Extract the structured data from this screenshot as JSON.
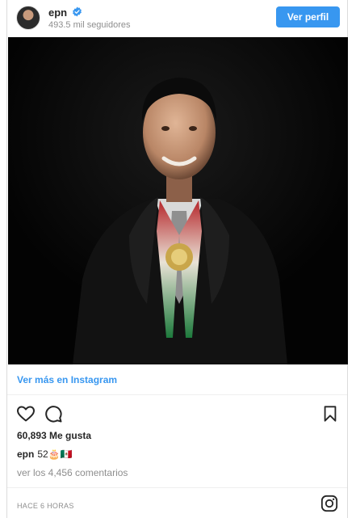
{
  "header": {
    "username": "epn",
    "followers": "493.5 mil seguidores",
    "view_profile_label": "Ver perfil"
  },
  "post": {
    "view_more_label": "Ver más en Instagram",
    "likes": "60,893 Me gusta",
    "caption_user": "epn",
    "caption_text": "52🎂🇲🇽",
    "comments_link": "ver los 4,456 comentarios",
    "time": "HACE 6 HORAS"
  },
  "icons": {
    "verified": "verified-badge-icon",
    "like": "heart-icon",
    "comment": "comment-icon",
    "save": "bookmark-icon",
    "brand": "instagram-icon"
  },
  "colors": {
    "accent": "#3897f0",
    "text": "#262626",
    "muted": "#8e8e8e",
    "photo_background": "#050505"
  }
}
